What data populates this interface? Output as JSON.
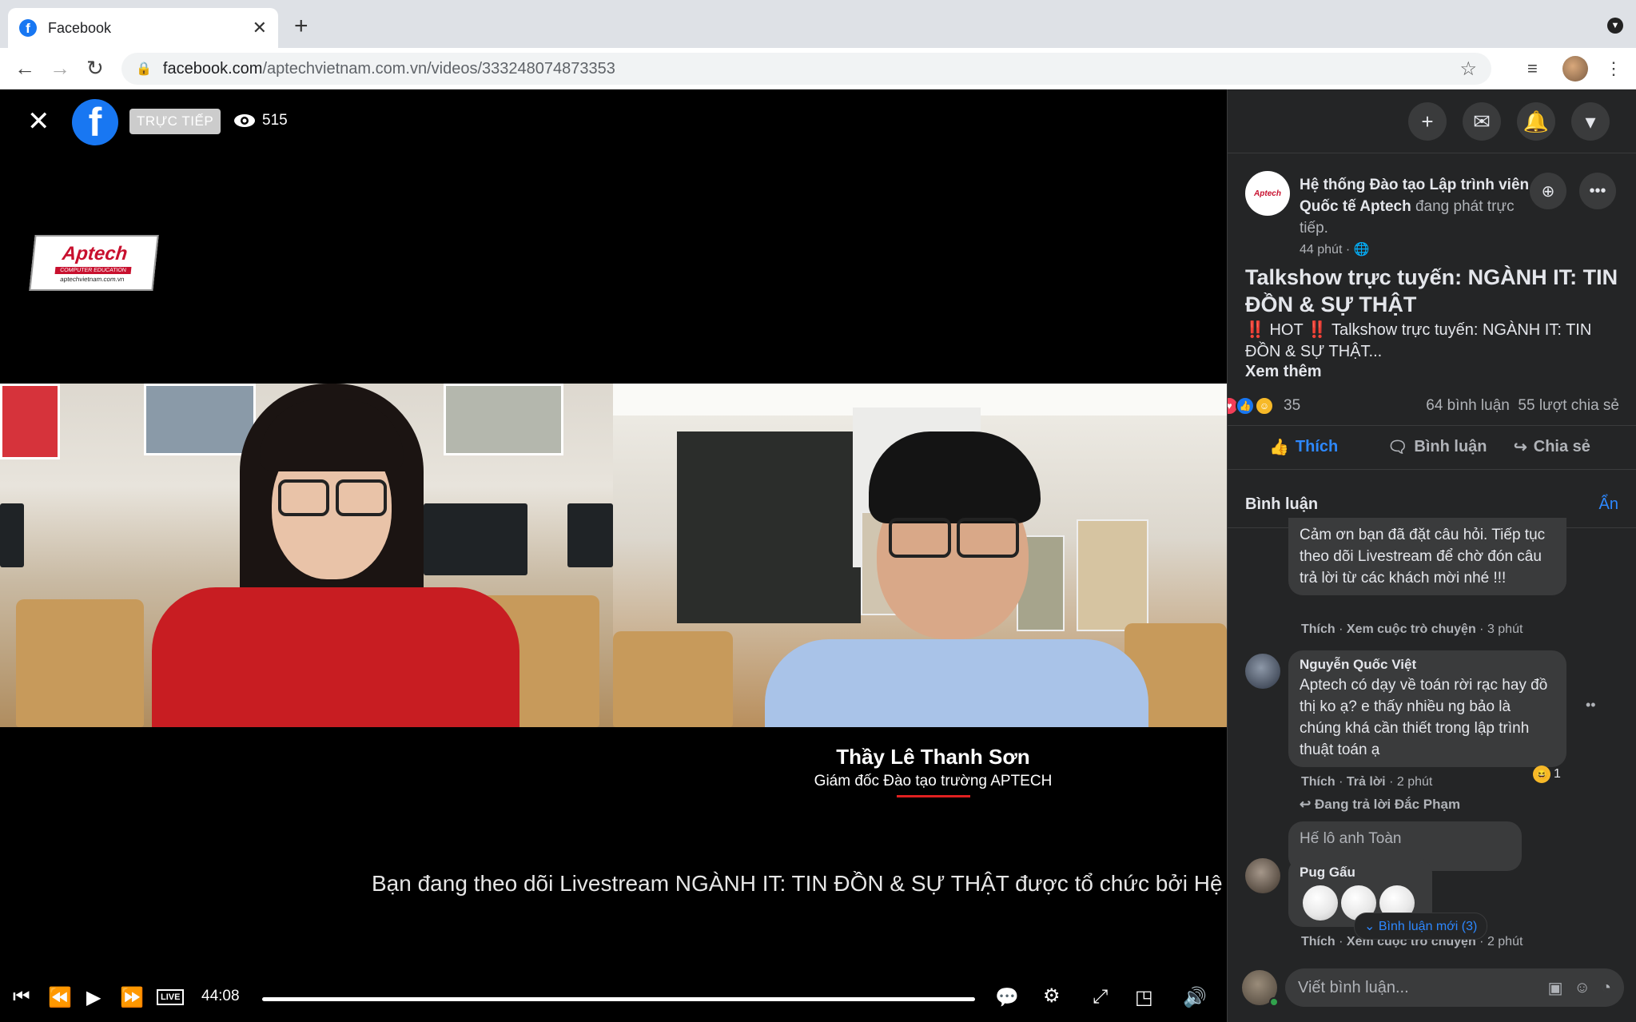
{
  "browser": {
    "tab_title": "Facebook",
    "new_tab": "+",
    "url_host": "facebook.com",
    "url_path": "/aptechvietnam.com.vn/videos/333248074873353"
  },
  "video": {
    "live_badge": "TRỰC TIẾP",
    "viewer_count": "515",
    "logo_brand": "Aptech",
    "logo_sub": "COMPUTER EDUCATION",
    "logo_site": "aptechvietnam.com.vn",
    "speaker_name": "Thầy Lê Thanh Sơn",
    "speaker_role": "Giám đốc Đào tạo trường APTECH",
    "ticker": "Bạn đang theo dõi Livestream NGÀNH IT: TIN ĐỒN & SỰ THẬT được tổ chức bởi Hệ th",
    "live_label": "LIVE",
    "time": "44:08",
    "progress": 1.0
  },
  "post": {
    "page_name": "Hệ thống Đào tạo Lập trình viên Quốc tế Aptech",
    "status": " đang phát trực tiếp.",
    "time": "44 phút · ",
    "title": "Talkshow trực tuyến: NGÀNH IT: TIN ĐỒN & SỰ THẬT",
    "body": "‼️ HOT ‼️ Talkshow trực tuyến: NGÀNH IT: TIN ĐỒN & SỰ THẬT...",
    "see_more": "Xem thêm",
    "reaction_count": "35",
    "comment_count": "64 bình luận",
    "share_count": "55 lượt chia sẻ",
    "like_label": "Thích",
    "comment_label": "Bình luận",
    "share_label": "Chia sẻ"
  },
  "comments": {
    "header": "Bình luận",
    "hide": "Ẩn",
    "items": [
      {
        "text": "Cảm ơn bạn đã đặt câu hỏi. Tiếp tục theo dõi Livestream để chờ đón câu trả lời từ các khách mời nhé !!!",
        "like": "Thích",
        "sep": " · ",
        "action": "Xem cuộc trò chuyện",
        "time": " · 3 phút"
      },
      {
        "author": "Nguyễn Quốc Việt",
        "text": "Aptech có dạy về toán rời rạc hay đồ thị ko ạ? e thấy nhiều ng bảo là chúng khá cần thiết trong lập trình thuật toán ạ",
        "like": "Thích",
        "sep": " · ",
        "action": "Trả lời",
        "time": " · 2 phút",
        "reaction_count": "1",
        "replying_to": "Đang trả lời Đắc Phạm"
      },
      {
        "quote": "Hế lô anh Toàn",
        "author": "Pug Gấu",
        "like": "Thích",
        "sep": " · ",
        "action": "Xem cuộc trò chuyện",
        "time": " · 2 phút"
      }
    ],
    "new_comments": "Bình luận mới (3)",
    "compose_placeholder": "Viết bình luận..."
  }
}
